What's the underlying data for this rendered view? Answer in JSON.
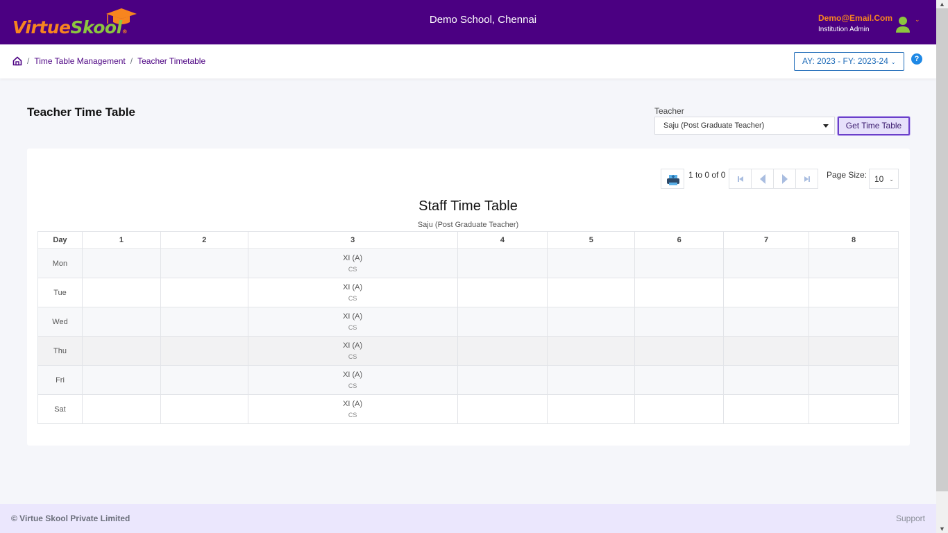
{
  "header": {
    "logo_part1": "Virtue",
    "logo_part2": "Skool",
    "logo_reg": "®",
    "school_name": "Demo School, Chennai",
    "user_email": "Demo@Email.Com",
    "user_role": "Institution Admin",
    "avatar_icon": "user-icon",
    "menu_caret": "⌄"
  },
  "breadcrumb": {
    "home_icon": "home-icon",
    "items": [
      "Time Table Management",
      "Teacher Timetable"
    ],
    "separator": "/"
  },
  "year_selector": {
    "value": "AY: 2023 - FY: 2023-24",
    "chevron": "⌄"
  },
  "help": {
    "icon": "help-icon",
    "glyph": "?"
  },
  "page": {
    "title": "Teacher Time Table",
    "teacher_label": "Teacher",
    "teacher_value": "Saju (Post Graduate Teacher)",
    "get_button": "Get Time Table"
  },
  "grid_toolbar": {
    "print_icon": "print-icon",
    "paging_info": "1 to 0 of 0",
    "pager_buttons": [
      "first-page",
      "previous-page",
      "next-page",
      "last-page"
    ],
    "page_size_label": "Page Size:",
    "page_size_value": "10"
  },
  "timetable": {
    "title": "Staff Time Table",
    "subtitle": "Saju (Post Graduate Teacher)",
    "columns": [
      "Day",
      "1",
      "2",
      "3",
      "4",
      "5",
      "6",
      "7",
      "8"
    ],
    "rows": [
      {
        "day": "Mon",
        "slots": [
          "",
          "",
          {
            "class": "XI (A)",
            "subject": "CS"
          },
          "",
          "",
          "",
          "",
          ""
        ]
      },
      {
        "day": "Tue",
        "slots": [
          "",
          "",
          {
            "class": "XI (A)",
            "subject": "CS"
          },
          "",
          "",
          "",
          "",
          ""
        ]
      },
      {
        "day": "Wed",
        "slots": [
          "",
          "",
          {
            "class": "XI (A)",
            "subject": "CS"
          },
          "",
          "",
          "",
          "",
          ""
        ]
      },
      {
        "day": "Thu",
        "slots": [
          "",
          "",
          {
            "class": "XI (A)",
            "subject": "CS"
          },
          "",
          "",
          "",
          "",
          ""
        ]
      },
      {
        "day": "Fri",
        "slots": [
          "",
          "",
          {
            "class": "XI (A)",
            "subject": "CS"
          },
          "",
          "",
          "",
          "",
          ""
        ]
      },
      {
        "day": "Sat",
        "slots": [
          "",
          "",
          {
            "class": "XI (A)",
            "subject": "CS"
          },
          "",
          "",
          "",
          "",
          ""
        ]
      }
    ]
  },
  "footer": {
    "copyright": "© Virtue Skool Private Limited",
    "support": "Support"
  },
  "colors": {
    "brand_purple": "#4b0082",
    "brand_orange": "#f7851f",
    "brand_green": "#8cc63f",
    "link_blue": "#1e6bb8",
    "footer_bg": "#ebe7fd"
  }
}
